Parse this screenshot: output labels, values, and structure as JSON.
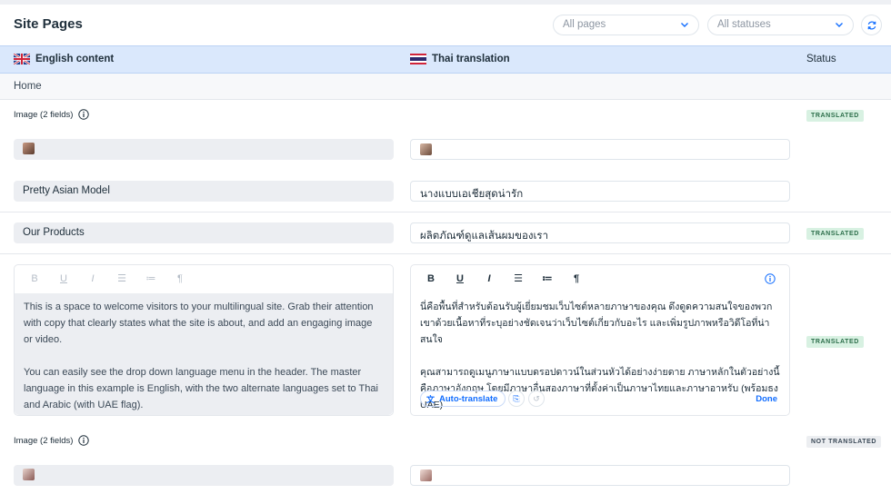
{
  "header": {
    "title": "Site Pages",
    "pages_filter": "All pages",
    "status_filter": "All statuses"
  },
  "columns": {
    "source": "English content",
    "target": "Thai translation",
    "status": "Status"
  },
  "page_name": "Home",
  "sections": {
    "image_group_1": {
      "label": "Image (2 fields)",
      "status": "TRANSLATED"
    },
    "alt_text": {
      "source": "Pretty Asian Model",
      "target": "นางแบบเอเชียสุดน่ารัก"
    },
    "products": {
      "source": "Our Products",
      "target": "ผลิตภัณฑ์ดูแลเส้นผมของเรา",
      "status": "TRANSLATED"
    },
    "rich_text": {
      "status": "TRANSLATED",
      "source_p1": "This is a space to welcome visitors to your multilingual site. Grab their attention with copy that clearly states what the site is about, and add an engaging image or video.",
      "source_p2": "You can easily see the drop down language menu in the header. The master language in this example is English, with the two alternate languages set to Thai and Arabic (with UAE flag).",
      "target_p1": "นี่คือพื้นที่สำหรับต้อนรับผู้เยี่ยมชมเว็บไซต์หลายภาษาของคุณ ดึงดูดความสนใจของพวกเขาด้วยเนื้อหาที่ระบุอย่างชัดเจนว่าเว็บไซต์เกี่ยวกับอะไร และเพิ่มรูปภาพหรือวิดีโอที่น่าสนใจ",
      "target_p2": "คุณสามารถดูเมนูภาษาแบบดรอปดาวน์ในส่วนหัวได้อย่างง่ายดาย ภาษาหลักในตัวอย่างนี้คือภาษาอังกฤษ โดยมีภาษาอื่นสองภาษาที่ตั้งค่าเป็นภาษาไทยและภาษาอาหรับ (พร้อมธง UAE)",
      "auto_translate": "Auto-translate",
      "done": "Done"
    },
    "image_group_2": {
      "label": "Image (2 fields)",
      "status": "NOT TRANSLATED"
    }
  },
  "colors": {
    "accent": "#116dff",
    "header_band": "#dae8fc",
    "translated_badge": "#d8f1e2",
    "not_translated_badge": "#eceef1"
  },
  "icons": {
    "uk_flag": "uk-flag-icon",
    "thai_flag": "thai-flag-icon",
    "info": "info-icon",
    "refresh": "refresh-icon",
    "chevron": "chevron-down-icon"
  }
}
